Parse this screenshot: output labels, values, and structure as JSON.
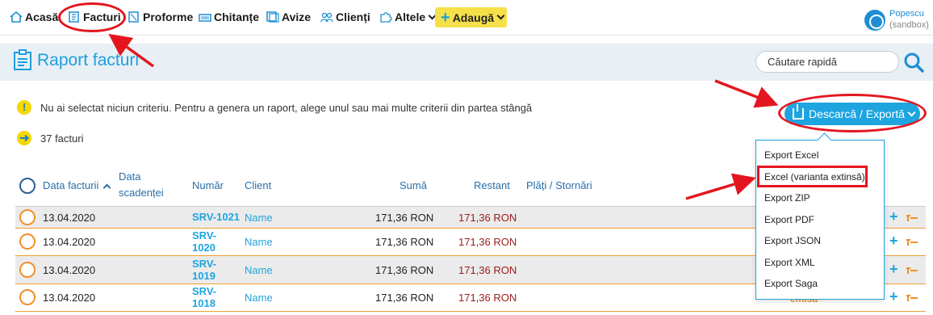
{
  "nav": {
    "items": [
      {
        "label": "Acasă"
      },
      {
        "label": "Facturi"
      },
      {
        "label": "Proforme"
      },
      {
        "label": "Chitanțe"
      },
      {
        "label": "Avize"
      },
      {
        "label": "Clienți"
      },
      {
        "label": "Altele"
      }
    ],
    "add_label": "Adaugă",
    "user_name": "Popescu",
    "user_sub": "(sandbox)"
  },
  "header": {
    "title": "Raport facturi",
    "search_placeholder": "Căutare rapidă"
  },
  "info": {
    "message": "Nu ai selectat niciun criteriu. Pentru a genera un raport, alege unul sau mai multe criterii din partea stângă",
    "count": "37 facturi"
  },
  "export": {
    "button_label": "Descarcă / Exportă",
    "options": [
      {
        "label": "Export Excel"
      },
      {
        "label": "Excel (varianta extinsă)"
      },
      {
        "label": "Export ZIP"
      },
      {
        "label": "Export PDF"
      },
      {
        "label": "Export JSON"
      },
      {
        "label": "Export XML"
      },
      {
        "label": "Export Saga"
      }
    ]
  },
  "table": {
    "columns": {
      "data_facturii": "Data facturii",
      "data_scadentei_1": "Data",
      "data_scadentei_2": "scadenței",
      "numar": "Număr",
      "client": "Client",
      "suma": "Sumă",
      "restant": "Restant",
      "plati": "Plăți / Stornări"
    },
    "rows": [
      {
        "date": "13.04.2020",
        "number_1": "SRV-1021",
        "number_2": "",
        "client": "Name",
        "sum": "171,36 RON",
        "due": "171,36 RON"
      },
      {
        "date": "13.04.2020",
        "number_1": "SRV-",
        "number_2": "1020",
        "client": "Name",
        "sum": "171,36 RON",
        "due": "171,36 RON"
      },
      {
        "date": "13.04.2020",
        "number_1": "SRV-",
        "number_2": "1019",
        "client": "Name",
        "sum": "171,36 RON",
        "due": "171,36 RON"
      },
      {
        "date": "13.04.2020",
        "number_1": "SRV-",
        "number_2": "1018",
        "client": "Name",
        "sum": "171,36 RON",
        "due": "171,36 RON",
        "status": "emisa"
      }
    ]
  },
  "colors": {
    "accent": "#1ea5e0",
    "annotation": "#e3161f",
    "add_button": "#f5e04a",
    "overdue": "#9c1b1b"
  }
}
